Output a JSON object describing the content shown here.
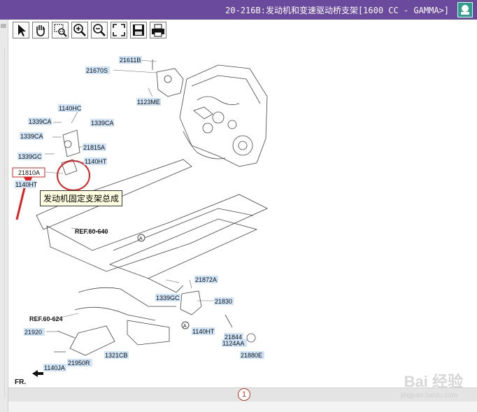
{
  "window": {
    "title": "20-216B:发动机和变速驱动桥支架[1600 CC - GAMMA>]"
  },
  "toolbar": {
    "buttons": [
      {
        "icon": "select-arrow-icon"
      },
      {
        "icon": "pan-hand-icon"
      },
      {
        "icon": "zoom-area-icon"
      },
      {
        "icon": "zoom-in-icon"
      },
      {
        "icon": "zoom-out-icon"
      },
      {
        "icon": "fit-screen-icon"
      },
      {
        "icon": "save-icon"
      },
      {
        "icon": "print-icon"
      }
    ]
  },
  "diagram": {
    "labels": {
      "p21611B": "21611B",
      "p21670S": "21670S",
      "p1123ME": "1123ME",
      "p1140HC": "1140HC",
      "p1339CA_a": "1339CA",
      "p1339CA_b": "1339CA",
      "p1339CA_c": "1339CA",
      "p21815A": "21815A",
      "p1339GC_a": "1339GC",
      "p1140HT_a": "1140HT",
      "p21810A": "21810A",
      "p1140HT_b": "1140HT",
      "ref60640": "REF.60-640",
      "refA1": "A",
      "p21872A": "21872A",
      "p1339GC_b": "1339GC",
      "p21830": "21830",
      "refA2": "A",
      "p1140HT_c": "1140HT",
      "p21844": "21844",
      "p1124AA": "1124AA",
      "ref60624": "REF.60-624",
      "p21920": "21920",
      "p1321CB": "1321CB",
      "p21950R": "21950R",
      "p1140JA": "1140JA",
      "p21880E": "21880E",
      "fr": "FR."
    },
    "tooltip": "发动机固定支架总成",
    "highlight_color": "#e02020",
    "label_bg": "#cfe4f7"
  },
  "status": {
    "page": "1"
  },
  "watermark": {
    "text": "Bai 经验",
    "url": "jingyan.baidu.com"
  }
}
